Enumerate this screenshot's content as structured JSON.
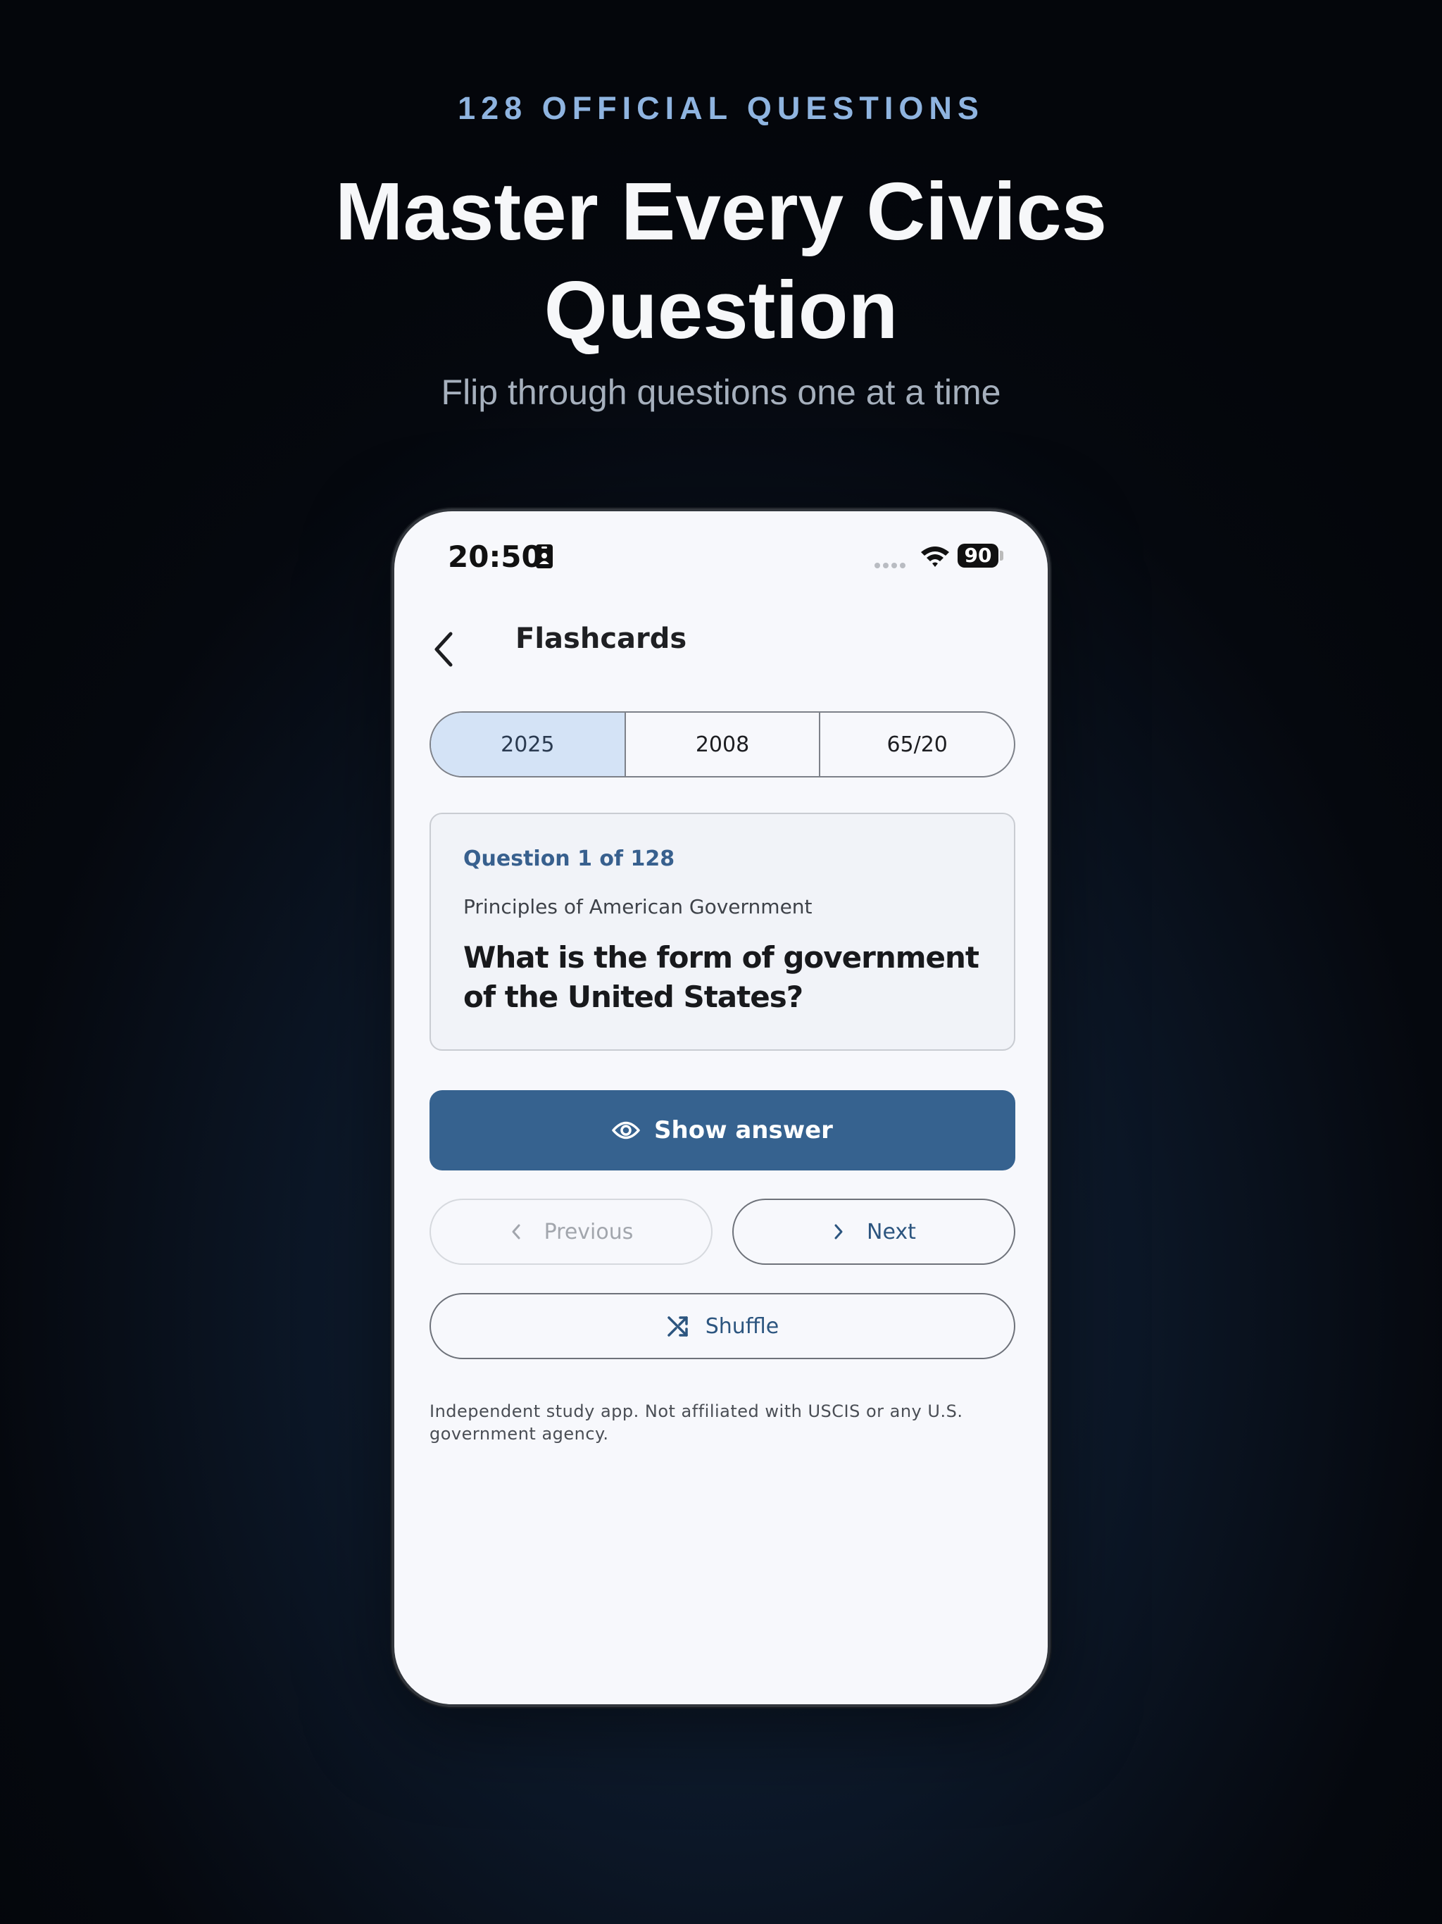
{
  "hero": {
    "eyebrow": "128 OFFICIAL QUESTIONS",
    "headline": "Master Every Civics Question",
    "subhead": "Flip through questions one at a time"
  },
  "status_bar": {
    "time": "20:50",
    "battery": "90"
  },
  "nav": {
    "title": "Flashcards"
  },
  "test_versions": [
    {
      "label": "2025",
      "selected": true
    },
    {
      "label": "2008",
      "selected": false
    },
    {
      "label": "65/20",
      "selected": false
    }
  ],
  "card": {
    "counter": "Question 1 of 128",
    "category": "Principles of American Government",
    "question": "What is the form of government of the United States?"
  },
  "actions": {
    "show_answer": "Show answer",
    "previous": "Previous",
    "next": "Next",
    "shuffle": "Shuffle"
  },
  "disclaimer": "Independent study app. Not affiliated with USCIS or any U.S. government agency.",
  "colors": {
    "accent": "#36628f",
    "segment_selected": "#d4e3f6",
    "eyebrow": "#8fb4e0"
  }
}
